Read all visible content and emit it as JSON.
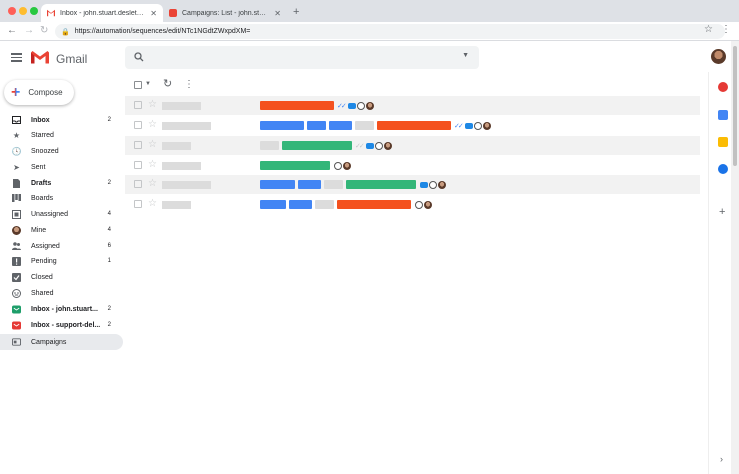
{
  "browser": {
    "tabs": [
      {
        "title": "Inbox - john.stuart.deslet@g...",
        "active": true,
        "favicon": "gmail-icon"
      },
      {
        "title": "Campaigns: List - john.stuart....",
        "active": false,
        "favicon": "campaigns-favicon"
      }
    ],
    "new_tab": "+",
    "url": "https://automation/sequences/edit/NTc1NGdtZWxpdXM="
  },
  "gmail": {
    "logo_text": "Gmail",
    "search": {
      "placeholder": ""
    }
  },
  "compose": {
    "label": "Compose"
  },
  "sidebar": {
    "items": [
      {
        "label": "Inbox",
        "count": "2",
        "bold": true,
        "icon": "inbox-icon"
      },
      {
        "label": "Starred",
        "count": "",
        "bold": false,
        "icon": "star-icon"
      },
      {
        "label": "Snoozed",
        "count": "",
        "bold": false,
        "icon": "clock-icon"
      },
      {
        "label": "Sent",
        "count": "",
        "bold": false,
        "icon": "send-icon"
      },
      {
        "label": "Drafts",
        "count": "2",
        "bold": true,
        "icon": "draft-icon"
      },
      {
        "label": "Boards",
        "count": "",
        "bold": false,
        "icon": "boards-icon"
      },
      {
        "label": "Unassigned",
        "count": "4",
        "bold": false,
        "icon": "unassigned-icon"
      },
      {
        "label": "Mine",
        "count": "4",
        "bold": false,
        "icon": "avatar-icon"
      },
      {
        "label": "Assigned",
        "count": "6",
        "bold": false,
        "icon": "assigned-icon"
      },
      {
        "label": "Pending",
        "count": "1",
        "bold": false,
        "icon": "pending-icon"
      },
      {
        "label": "Closed",
        "count": "",
        "bold": false,
        "icon": "closed-check-icon"
      },
      {
        "label": "Shared",
        "count": "",
        "bold": false,
        "icon": "shared-icon"
      },
      {
        "label": "Inbox - john.stuart...",
        "count": "2",
        "bold": true,
        "icon": "shared-inbox-green-icon"
      },
      {
        "label": "Inbox - support-del...",
        "count": "2",
        "bold": true,
        "icon": "shared-inbox-red-icon"
      },
      {
        "label": "Campaigns",
        "count": "",
        "bold": false,
        "icon": "campaigns-icon",
        "active": true
      }
    ]
  },
  "colors": {
    "red": "#f4511e",
    "blue": "#4285f4",
    "green": "#33b679",
    "grey": "#dcdcdc"
  },
  "side_panel": {
    "icons": [
      "gmelius-icon",
      "calendar-icon",
      "keep-icon",
      "tasks-icon",
      "add-icon"
    ]
  }
}
